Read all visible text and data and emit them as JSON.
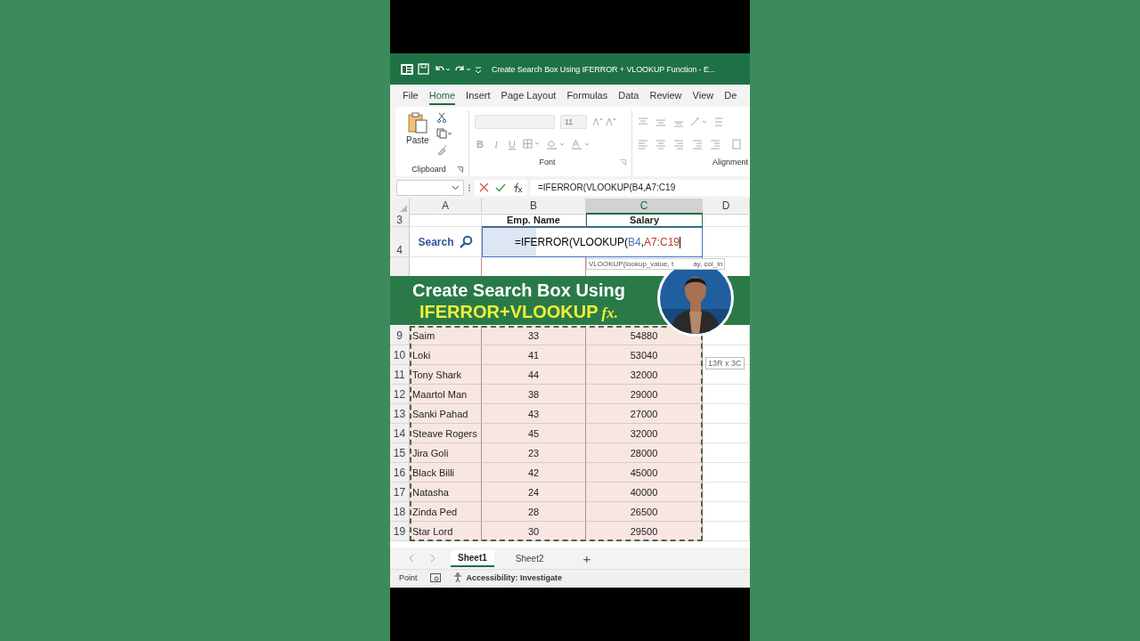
{
  "title_bar": {
    "title": "Create Search Box Using IFERROR + VLOOKUP Function  -  E..."
  },
  "ribbon_tabs": [
    {
      "label": "File",
      "selected": false
    },
    {
      "label": "Home",
      "selected": true
    },
    {
      "label": "Insert",
      "selected": false
    },
    {
      "label": "Page Layout",
      "selected": false
    },
    {
      "label": "Formulas",
      "selected": false
    },
    {
      "label": "Data",
      "selected": false
    },
    {
      "label": "Review",
      "selected": false
    },
    {
      "label": "View",
      "selected": false
    },
    {
      "label": "De",
      "selected": false
    }
  ],
  "ribbon": {
    "paste_label": "Paste",
    "font_size": "11",
    "font_buttons": [
      "B",
      "I",
      "U"
    ],
    "groups": [
      "Clipboard",
      "Font",
      "Alignment"
    ]
  },
  "formula_bar": {
    "formula": "=IFERROR(VLOOKUP(B4,A7:C19"
  },
  "columns": [
    {
      "label": "A",
      "selected": false
    },
    {
      "label": "B",
      "selected": false
    },
    {
      "label": "C",
      "selected": true
    },
    {
      "label": "D",
      "selected": false
    }
  ],
  "header_row": {
    "row": "3",
    "cells": [
      "Emp. Name",
      "Salary"
    ]
  },
  "search_row": {
    "row": "4",
    "label": "Search",
    "formula_parts": [
      {
        "text": "=IFERROR(VLOOKUP("
      },
      {
        "text": "B4",
        "color": "#4472c4"
      },
      {
        "text": ","
      },
      {
        "text": "A7:C19",
        "color": "#c0392b"
      }
    ]
  },
  "tooltip": {
    "parts": [
      "VLOOKUP(lookup_value, t",
      "ay, col_in"
    ]
  },
  "banner": {
    "line1": "Create Search Box Using",
    "line2": "IFERROR+VLOOKUP",
    "fx": "fx."
  },
  "data_rows": [
    {
      "row": "9",
      "name": "Saim",
      "age": "33",
      "salary": "54880"
    },
    {
      "row": "10",
      "name": "Loki",
      "age": "41",
      "salary": "53040"
    },
    {
      "row": "11",
      "name": "Tony Shark",
      "age": "44",
      "salary": "32000"
    },
    {
      "row": "12",
      "name": "Maartol Man",
      "age": "38",
      "salary": "29000"
    },
    {
      "row": "13",
      "name": "Sanki Pahad",
      "age": "43",
      "salary": "27000"
    },
    {
      "row": "14",
      "name": "Steave Rogers",
      "age": "45",
      "salary": "32000"
    },
    {
      "row": "15",
      "name": "Jira Goli",
      "age": "23",
      "salary": "28000"
    },
    {
      "row": "16",
      "name": "Black Billi",
      "age": "42",
      "salary": "45000"
    },
    {
      "row": "17",
      "name": "Natasha",
      "age": "24",
      "salary": "40000"
    },
    {
      "row": "18",
      "name": "Zinda Ped",
      "age": "28",
      "salary": "26500"
    },
    {
      "row": "19",
      "name": "Star Lord",
      "age": "30",
      "salary": "29500"
    }
  ],
  "range_hint": "13R x 3C",
  "sheet_tabs": [
    {
      "label": "Sheet1",
      "selected": true
    },
    {
      "label": "Sheet2",
      "selected": false
    }
  ],
  "add_sheet": "+",
  "status_bar": {
    "mode": "Point",
    "accessibility": "Accessibility: Investigate"
  }
}
